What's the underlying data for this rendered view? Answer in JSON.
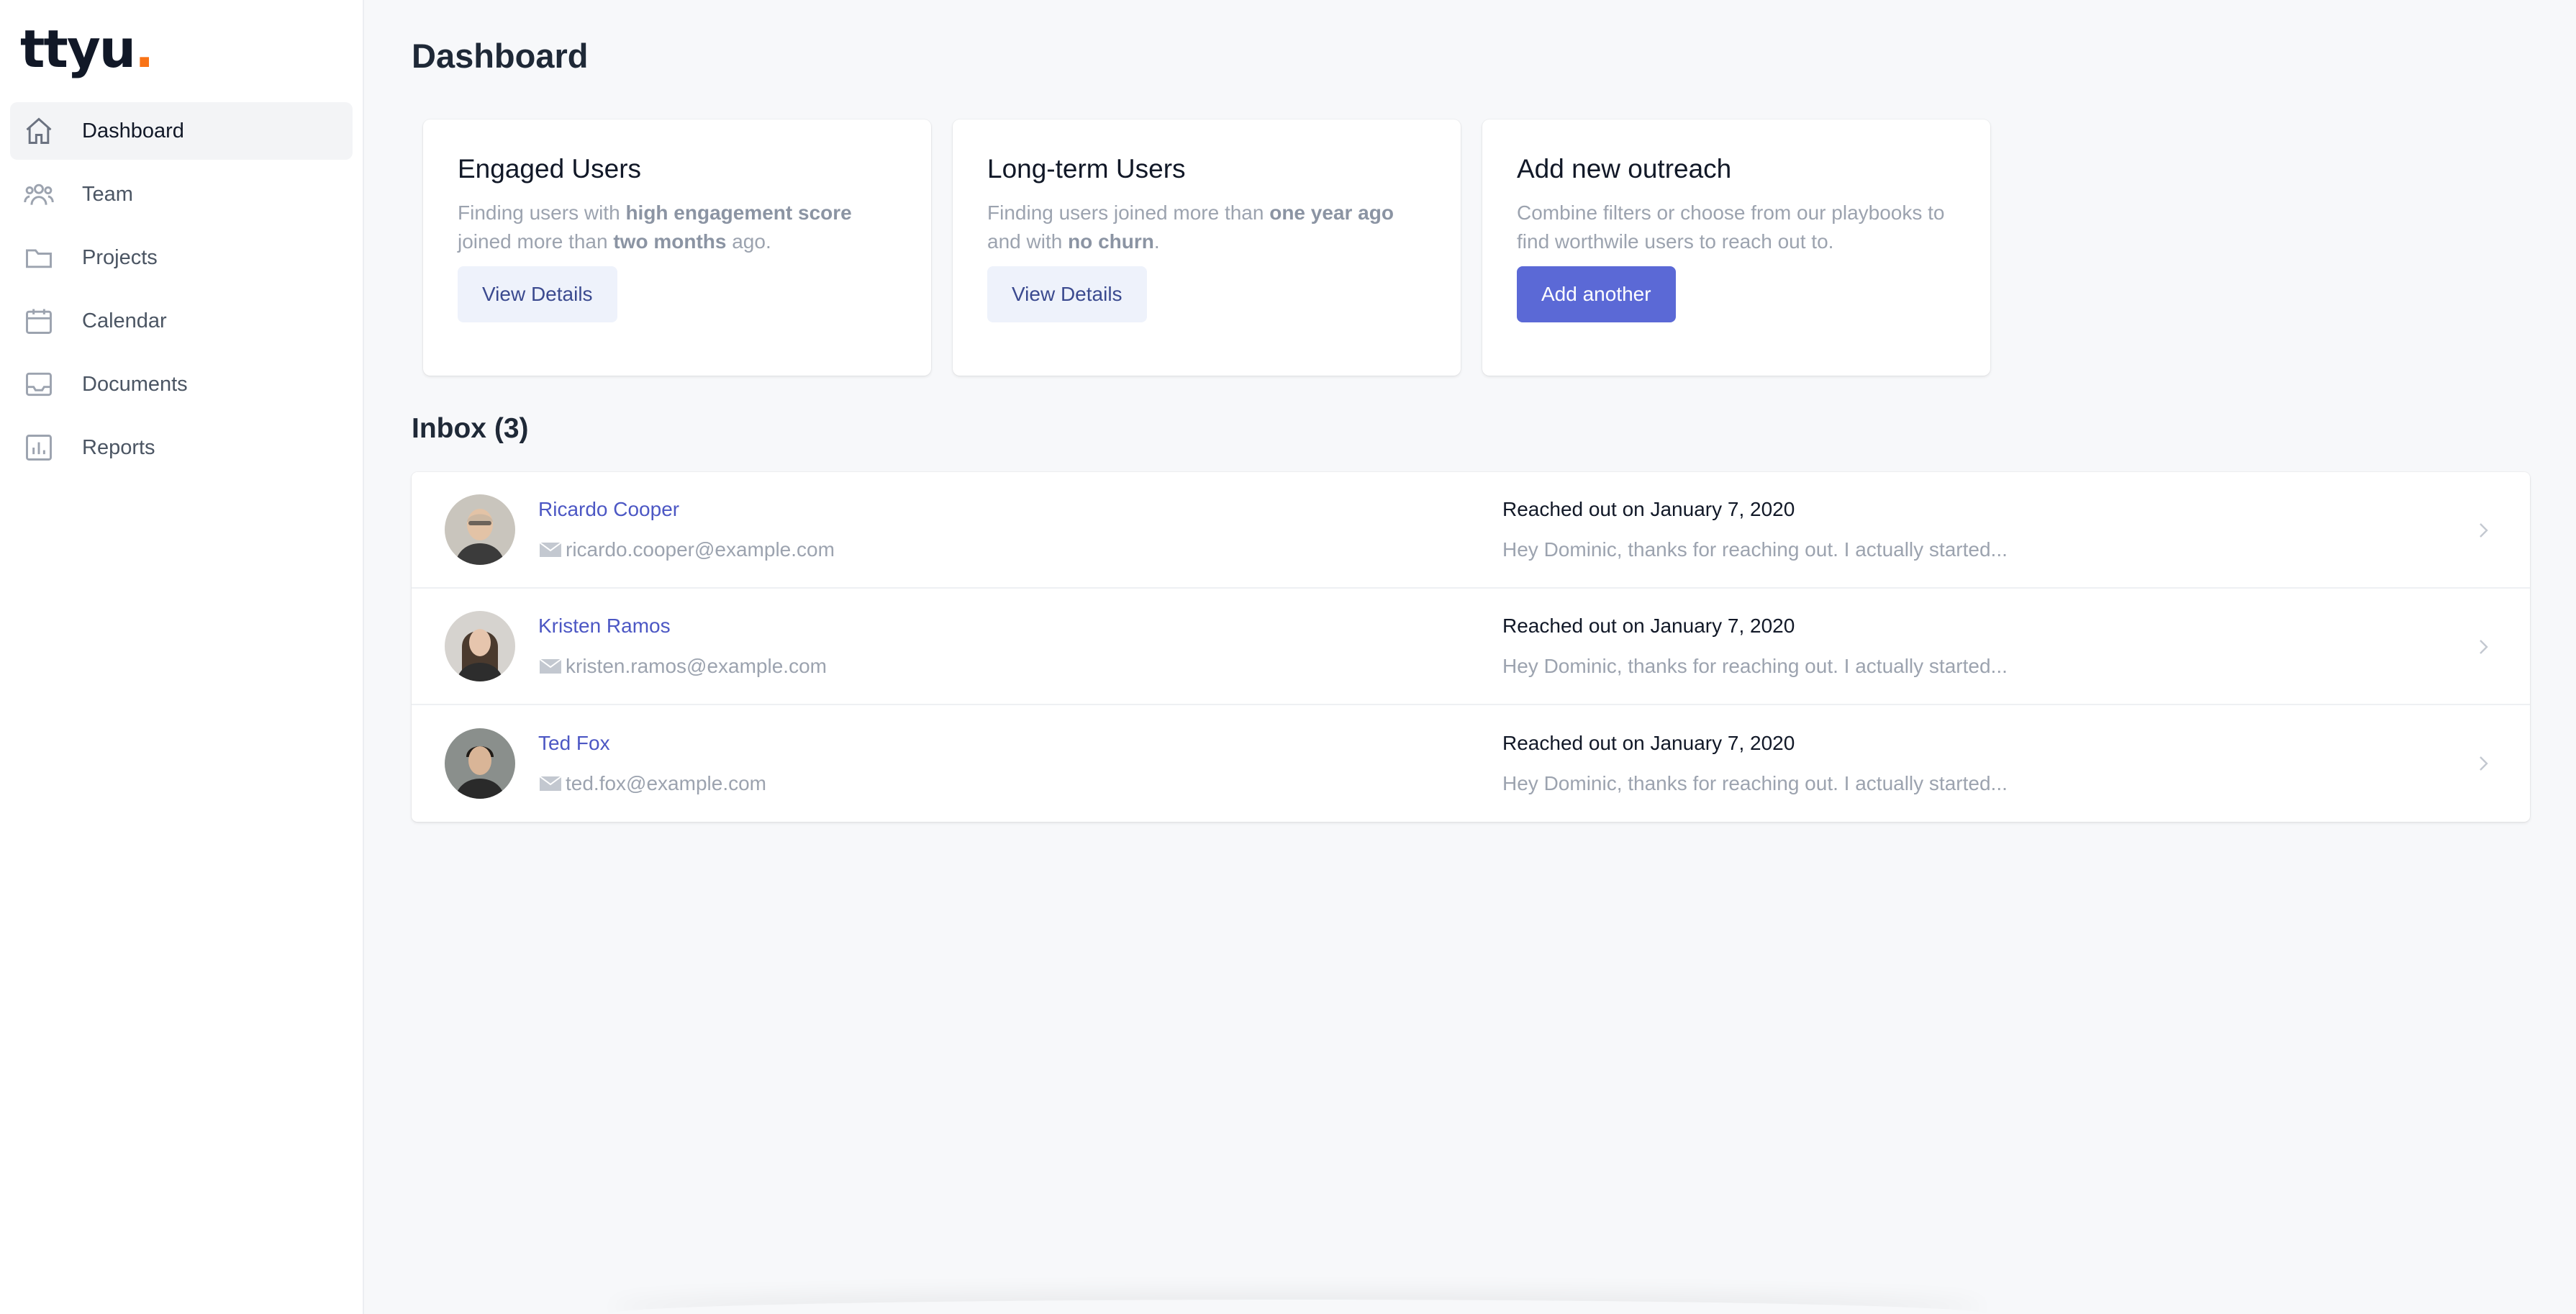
{
  "brand": {
    "name": "ttyu",
    "dot": ".",
    "accent": "#f97316"
  },
  "sidebar": {
    "items": [
      {
        "label": "Dashboard",
        "icon": "home-icon",
        "active": true
      },
      {
        "label": "Team",
        "icon": "users-icon"
      },
      {
        "label": "Projects",
        "icon": "folder-icon"
      },
      {
        "label": "Calendar",
        "icon": "calendar-icon"
      },
      {
        "label": "Documents",
        "icon": "inbox-icon"
      },
      {
        "label": "Reports",
        "icon": "chart-icon"
      }
    ]
  },
  "main": {
    "title": "Dashboard",
    "cards": [
      {
        "title": "Engaged Users",
        "desc_parts": [
          "Finding users with ",
          "high engagement score",
          " joined more than ",
          "two months",
          " ago."
        ],
        "button": "View Details"
      },
      {
        "title": "Long-term Users",
        "desc_parts": [
          "Finding users joined more than ",
          "one year ago",
          " and with ",
          "no churn",
          "."
        ],
        "button": "View Details"
      },
      {
        "title": "Add new outreach",
        "desc": "Combine filters or choose from our playbooks to find worthwile users to reach out to.",
        "button": "Add another"
      }
    ],
    "inbox": {
      "title": "Inbox (3)",
      "rows": [
        {
          "name": "Ricardo Cooper",
          "email": "ricardo.cooper@example.com",
          "reached": "Reached out on January 7, 2020",
          "preview": "Hey Dominic, thanks for reaching out. I actually started..."
        },
        {
          "name": "Kristen Ramos",
          "email": "kristen.ramos@example.com",
          "reached": "Reached out on January 7, 2020",
          "preview": "Hey Dominic, thanks for reaching out. I actually started..."
        },
        {
          "name": "Ted Fox",
          "email": "ted.fox@example.com",
          "reached": "Reached out on January 7, 2020",
          "preview": "Hey Dominic, thanks for reaching out. I actually started..."
        }
      ]
    }
  },
  "colors": {
    "primary": "#5b69d6",
    "link": "#4c57c4",
    "muted": "#9ca3af"
  }
}
